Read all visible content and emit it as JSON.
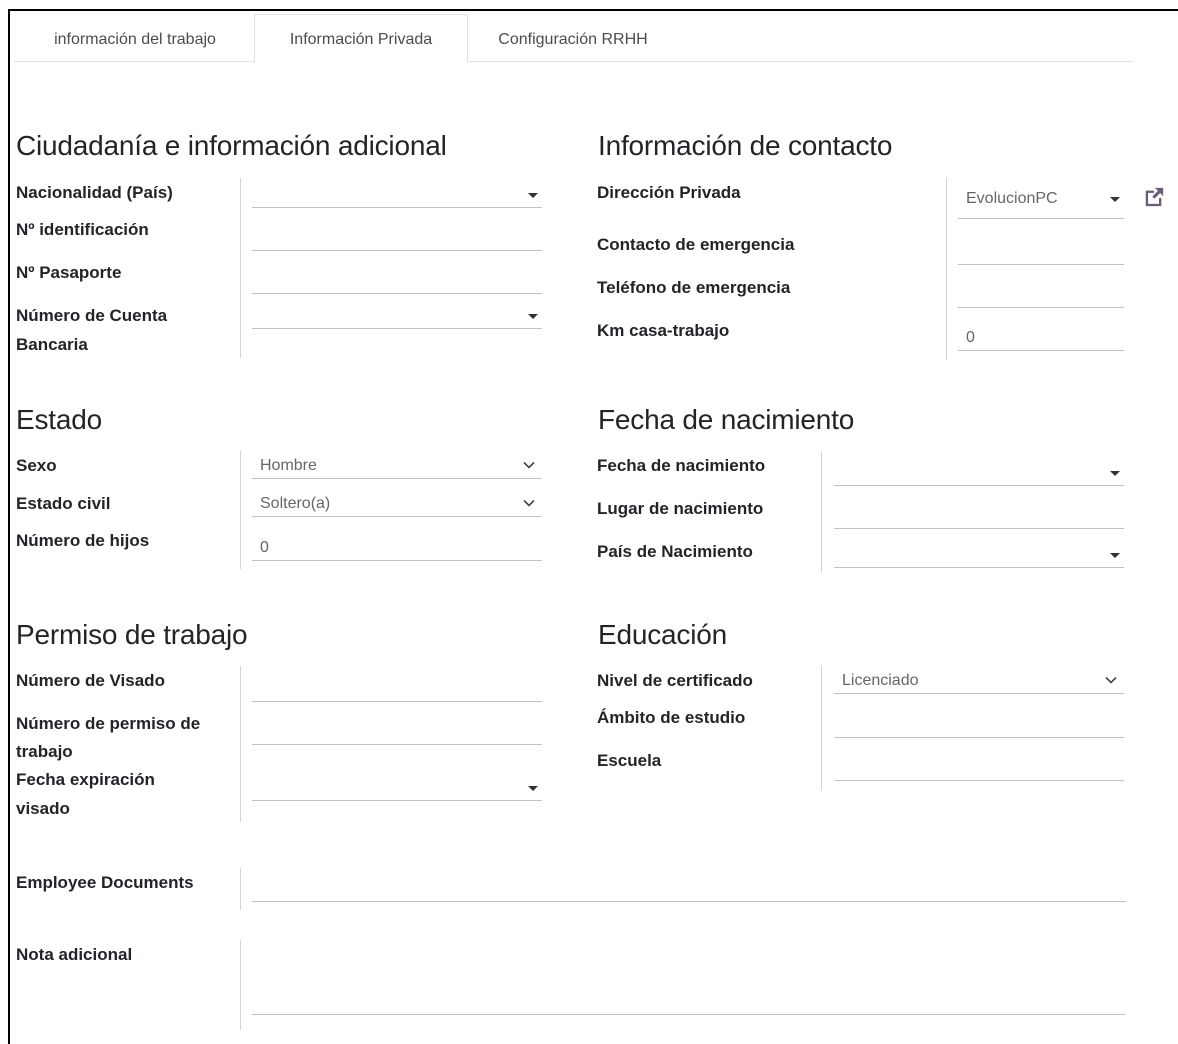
{
  "tabs": [
    "información del trabajo",
    "Información Privada",
    "Configuración RRHH"
  ],
  "sections": {
    "ciudadania": {
      "title": "Ciudadanía e información adicional",
      "nacionalidad": "Nacionalidad (País)",
      "identificacion": "Nº identificación",
      "pasaporte": "Nº Pasaporte",
      "cuenta_l1": "Número de Cuenta",
      "cuenta_l2": "Bancaria"
    },
    "contacto": {
      "title": "Información de contacto",
      "direccion": "Dirección Privada",
      "direccion_value": "EvolucionPC",
      "emergencia": "Contacto de emergencia",
      "telefono": "Teléfono de emergencia",
      "km": "Km casa-trabajo",
      "km_value": "0"
    },
    "estado": {
      "title": "Estado",
      "sexo": "Sexo",
      "sexo_value": "Hombre",
      "civil": "Estado civil",
      "civil_value": "Soltero(a)",
      "hijos": "Número de hijos",
      "hijos_value": "0"
    },
    "nacimiento": {
      "title": "Fecha de nacimiento",
      "fecha": "Fecha de nacimiento",
      "lugar": "Lugar de nacimiento",
      "pais": "País de Nacimiento"
    },
    "permiso": {
      "title": "Permiso de trabajo",
      "visado": "Número de Visado",
      "permiso_l1": "Número de permiso de",
      "permiso_l2": "trabajo",
      "expiracion_l1": "Fecha expiración",
      "expiracion_l2": "visado"
    },
    "educacion": {
      "title": "Educación",
      "nivel": "Nivel de certificado",
      "nivel_value": "Licenciado",
      "ambito": "Ámbito de estudio",
      "escuela": "Escuela"
    },
    "documents": "Employee Documents",
    "nota": "Nota adicional"
  }
}
